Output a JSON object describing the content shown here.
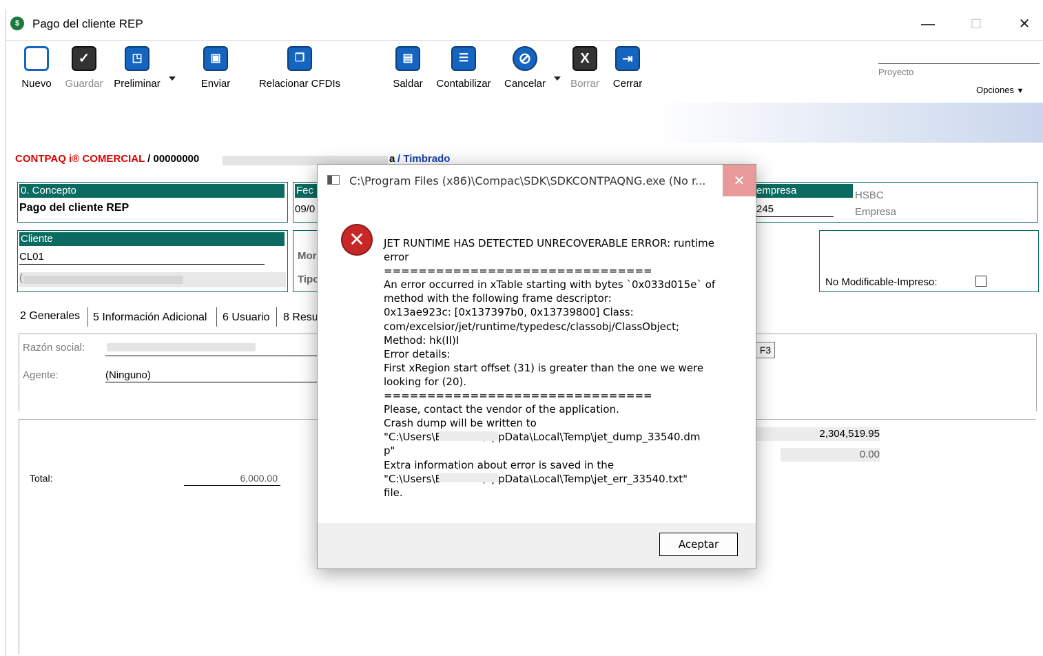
{
  "window": {
    "title": "Pago del cliente REP",
    "minimize": "—",
    "maximize": "☐",
    "close": "✕"
  },
  "toolbar": {
    "buttons": [
      {
        "label": "Nuevo"
      },
      {
        "label": "Guardar"
      },
      {
        "label": "Preliminar"
      },
      {
        "label": "Enviar"
      },
      {
        "label": "Relacionar CFDIs"
      },
      {
        "label": "Saldar"
      },
      {
        "label": "Contabilizar"
      },
      {
        "label": "Cancelar"
      },
      {
        "label": "Borrar"
      },
      {
        "label": "Cerrar"
      }
    ],
    "proyecto_label": "Proyecto",
    "opciones_label": "Opciones"
  },
  "header": {
    "brand": "CONTPAQ i® COMERCIAL",
    "doc_number": " / 00000000",
    "tail": "a",
    "status": " / Timbrado"
  },
  "form": {
    "concepto_label": "0. Concepto",
    "concepto_value": "Pago del cliente REP",
    "fecha_label": "Fec",
    "fecha_value": "09/0",
    "empresa_label": "empresa",
    "empresa_value": "245",
    "bank": "HSBC",
    "empresa_sub": "Empresa",
    "cliente_label": "Cliente",
    "cliente_value": "CL01",
    "cliente_name_prefix": "(",
    "moneda_label": "Mor",
    "tipo_label": "Tipo",
    "no_modificable_label": "No Modificable-Impreso:"
  },
  "tabs": [
    {
      "label": "2 Generales"
    },
    {
      "label": "5 Información Adicional"
    },
    {
      "label": "6 Usuario"
    },
    {
      "label": "8 Resu"
    }
  ],
  "generales": {
    "razon_social_label": "Razón social:",
    "agente_label": "Agente:",
    "agente_value": "(Ninguno)",
    "f3_label": "F3",
    "total_label": "Total:",
    "total_value": "6,000.00",
    "amount_1": "2,304,519.95",
    "amount_2": "0.00"
  },
  "dialog": {
    "title": "C:\\Program Files (x86)\\Compac\\SDK\\SDKCONTPAQNG.exe (No r...",
    "close": "✕",
    "message": "JET RUNTIME HAS DETECTED UNRECOVERABLE ERROR: runtime\nerror\n===============================\nAn error occurred in xTable starting with bytes `0x033d015e` of\nmethod with the following frame descriptor:\n0x13ae923c: [0x137397b0, 0x13739800] Class:\ncom/excelsior/jet/runtime/typedesc/classobj/ClassObject;\nMethod: hk(II)I\nError details:\nFirst xRegion start offset (31) is greater than the one we were\nlooking for (20).\n===============================\nPlease, contact the vendor of the application.\nCrash dump will be written to\n\"C:\\Users\\E            \\AppData\\Local\\Temp\\jet_dump_33540.dm\np\"\nExtra information about error is saved in the\n\"C:\\Users\\E            \\AppData\\Local\\Temp\\jet_err_33540.txt\"\nfile.",
    "ok_label": "Aceptar"
  }
}
